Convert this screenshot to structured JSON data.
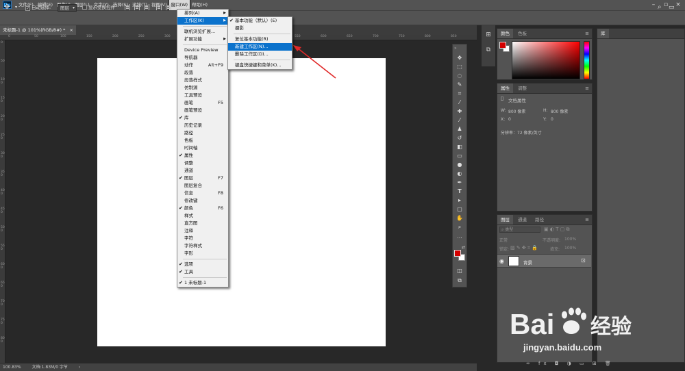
{
  "app": {
    "logo_text": "Ps"
  },
  "menubar": {
    "items": [
      "文件(F)",
      "编辑(E)",
      "图像(I)",
      "图层(L)",
      "文字(Y)",
      "选择(S)",
      "滤镜(T)",
      "视图(V)",
      "窗口(W)",
      "帮助(H)"
    ],
    "active_index": 8
  },
  "options_bar": {
    "auto_select_label": "自动选择:",
    "auto_select_value": "图层",
    "show_transform_label": "显示变换控件",
    "mode_3d_label": "3D 模式:"
  },
  "document": {
    "tab_title": "未标题-1 @ 101%(RGB/8#) *",
    "close_glyph": "×"
  },
  "rulers": {
    "top_ticks": [
      "0",
      "50",
      "100",
      "150",
      "200",
      "250",
      "300",
      "350",
      "400",
      "450",
      "500",
      "550",
      "600",
      "650",
      "700",
      "750",
      "800",
      "850"
    ],
    "left_ticks": [
      "0",
      "50",
      "100",
      "150",
      "200",
      "250",
      "300",
      "350",
      "400",
      "450",
      "500",
      "550",
      "600",
      "650",
      "700",
      "750",
      "800"
    ]
  },
  "status_bar": {
    "zoom": "100.83%",
    "doc_info": "文档:1.83M/0 字节"
  },
  "window_menu": {
    "items": [
      {
        "label": "排列(A)",
        "submenu": true
      },
      {
        "label": "工作区(K)",
        "submenu": true,
        "highlight": true
      },
      {
        "sep": true
      },
      {
        "label": "联机浏览扩展..."
      },
      {
        "label": "扩展功能",
        "submenu": true
      },
      {
        "sep": true
      },
      {
        "label": "Device Preview"
      },
      {
        "label": "导航器"
      },
      {
        "label": "动作",
        "shortcut": "Alt+F9"
      },
      {
        "label": "段落"
      },
      {
        "label": "段落样式"
      },
      {
        "label": "仿制源"
      },
      {
        "label": "工具预设"
      },
      {
        "label": "画笔",
        "shortcut": "F5"
      },
      {
        "label": "画笔预设"
      },
      {
        "label": "库",
        "checked": true
      },
      {
        "label": "历史记录"
      },
      {
        "label": "路径"
      },
      {
        "label": "色板"
      },
      {
        "label": "时间轴"
      },
      {
        "label": "属性",
        "checked": true
      },
      {
        "label": "调整"
      },
      {
        "label": "通道"
      },
      {
        "label": "图层",
        "checked": true,
        "shortcut": "F7"
      },
      {
        "label": "图层复合"
      },
      {
        "label": "信息",
        "shortcut": "F8"
      },
      {
        "label": "修改键"
      },
      {
        "label": "颜色",
        "checked": true,
        "shortcut": "F6"
      },
      {
        "label": "样式"
      },
      {
        "label": "直方图"
      },
      {
        "label": "注释"
      },
      {
        "label": "字符"
      },
      {
        "label": "字符样式"
      },
      {
        "label": "字形"
      },
      {
        "sep": true
      },
      {
        "label": "选项",
        "checked": true
      },
      {
        "label": "工具",
        "checked": true
      },
      {
        "sep": true
      },
      {
        "label": "1 未标题-1",
        "checked": true
      }
    ]
  },
  "workspace_submenu": {
    "items": [
      {
        "label": "基本功能（默认）(E)",
        "checked": true
      },
      {
        "label": "摄影"
      },
      {
        "sep": true
      },
      {
        "label": "复位基本功能(R)"
      },
      {
        "label": "新建工作区(N)...",
        "highlight": true
      },
      {
        "label": "删除工作区(D)..."
      },
      {
        "sep": true
      },
      {
        "label": "键盘快捷键和菜单(K)..."
      }
    ]
  },
  "panels": {
    "color": {
      "tabs": [
        "颜色",
        "色板"
      ],
      "fg_color": "#d40000",
      "bg_color": "#ffffff"
    },
    "library": {
      "tab": "库"
    },
    "properties": {
      "tabs": [
        "属性",
        "调整"
      ],
      "title": "文档属性",
      "w_label": "W:",
      "w_value": "800 像素",
      "h_label": "H:",
      "h_value": "800 像素",
      "x_label": "X:",
      "x_value": "0",
      "y_label": "Y:",
      "y_value": "0",
      "resolution": "分辨率：72 像素/英寸"
    },
    "layers": {
      "tabs": [
        "图层",
        "通道",
        "路径"
      ],
      "filter_label": "类型",
      "blend_mode": "正常",
      "opacity_label": "不透明度:",
      "opacity_value": "100%",
      "lock_label": "锁定:",
      "fill_label": "填充:",
      "fill_value": "100%",
      "layer_name": "背景"
    }
  },
  "watermark": {
    "logo_text": "Bai",
    "logo_suffix": "经验",
    "url": "jingyan.baidu.com"
  },
  "colors": {
    "highlight": "#0b72cc",
    "arrow": "#e02828",
    "chrome": "#535353"
  }
}
